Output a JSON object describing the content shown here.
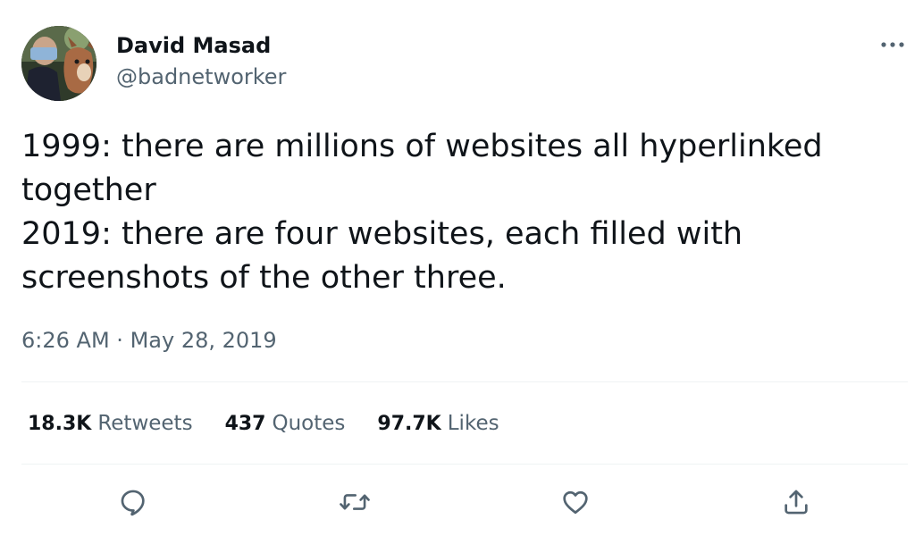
{
  "author": {
    "name": "David Masad",
    "handle": "@badnetworker",
    "avatar_icon": "avatar-photo"
  },
  "more_icon": "more-horizontal-icon",
  "tweet": {
    "text": "1999: there are millions of websites all hyperlinked\ntogether\n2019: there are four websites, each filled with\nscreenshots of the other three.",
    "time": "6:26 AM",
    "separator": "·",
    "date": "May 28, 2019"
  },
  "stats": {
    "retweets_count": "18.3K",
    "retweets_label": "Retweets",
    "quotes_count": "437",
    "quotes_label": "Quotes",
    "likes_count": "97.7K",
    "likes_label": "Likes"
  },
  "actions": {
    "reply_icon": "reply-icon",
    "retweet_icon": "retweet-icon",
    "like_icon": "heart-icon",
    "share_icon": "share-icon"
  },
  "colors": {
    "text": "#0f1419",
    "secondary": "#536471",
    "icon": "#536471",
    "divider": "#eff3f4"
  }
}
